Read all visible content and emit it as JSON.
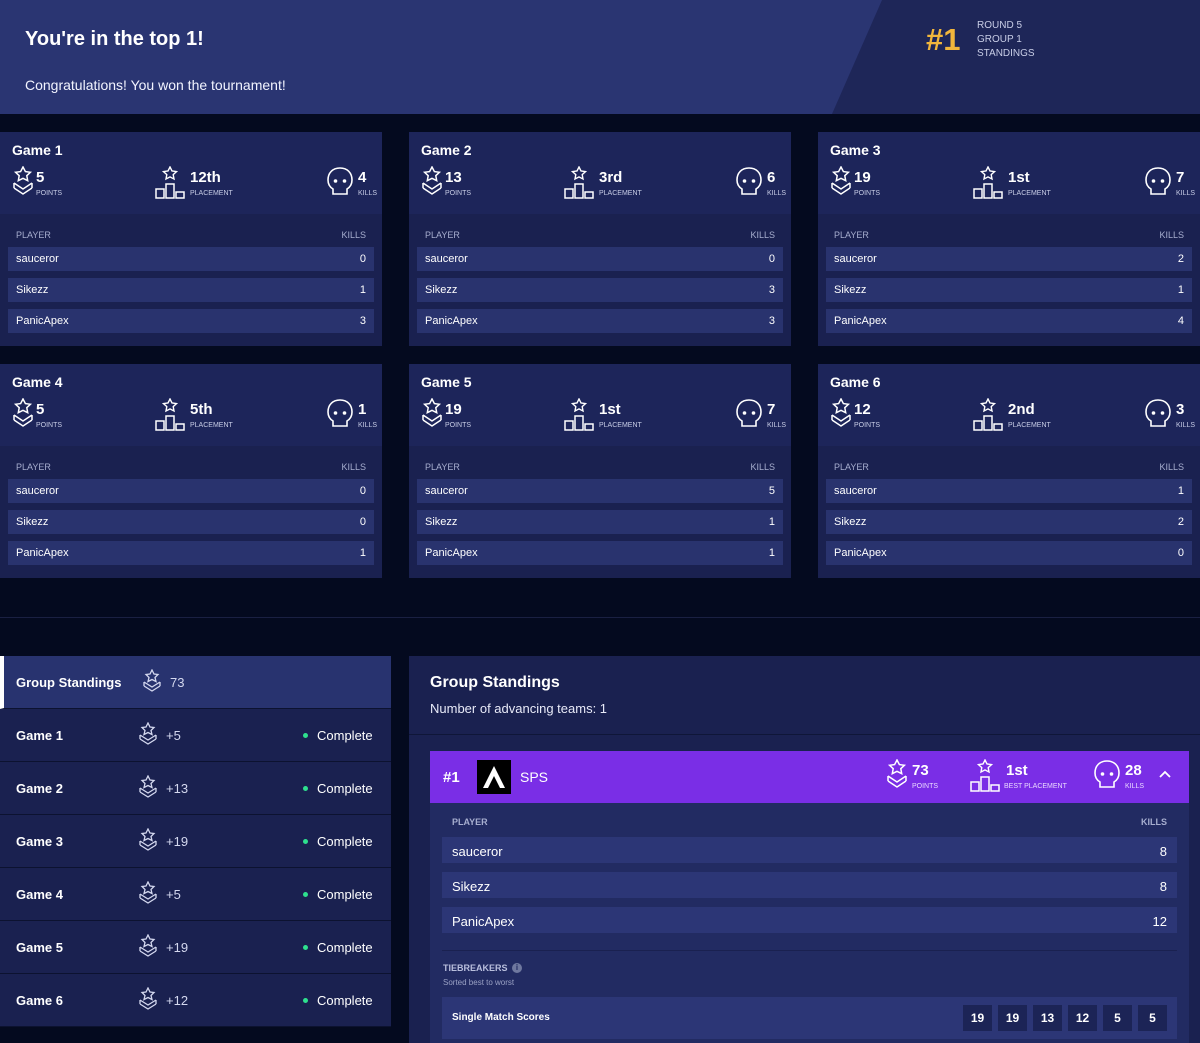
{
  "banner": {
    "title": "You're in the top 1!",
    "subtitle": "Congratulations! You won the tournament!",
    "rank": "#1",
    "meta": [
      "ROUND 5",
      "GROUP 1",
      "STANDINGS"
    ]
  },
  "labels": {
    "points": "POINTS",
    "placement": "PLACEMENT",
    "kills": "KILLS",
    "player": "PLAYER",
    "kills_col": "KILLS"
  },
  "games": [
    {
      "title": "Game 1",
      "points": "5",
      "placement": "12th",
      "kills": "4",
      "players": [
        [
          "sauceror",
          "0"
        ],
        [
          "Sikezz",
          "1"
        ],
        [
          "PanicApex",
          "3"
        ]
      ]
    },
    {
      "title": "Game 2",
      "points": "13",
      "placement": "3rd",
      "kills": "6",
      "players": [
        [
          "sauceror",
          "0"
        ],
        [
          "Sikezz",
          "3"
        ],
        [
          "PanicApex",
          "3"
        ]
      ]
    },
    {
      "title": "Game 3",
      "points": "19",
      "placement": "1st",
      "kills": "7",
      "players": [
        [
          "sauceror",
          "2"
        ],
        [
          "Sikezz",
          "1"
        ],
        [
          "PanicApex",
          "4"
        ]
      ]
    },
    {
      "title": "Game 4",
      "points": "5",
      "placement": "5th",
      "kills": "1",
      "players": [
        [
          "sauceror",
          "0"
        ],
        [
          "Sikezz",
          "0"
        ],
        [
          "PanicApex",
          "1"
        ]
      ]
    },
    {
      "title": "Game 5",
      "points": "19",
      "placement": "1st",
      "kills": "7",
      "players": [
        [
          "sauceror",
          "5"
        ],
        [
          "Sikezz",
          "1"
        ],
        [
          "PanicApex",
          "1"
        ]
      ]
    },
    {
      "title": "Game 6",
      "points": "12",
      "placement": "2nd",
      "kills": "3",
      "players": [
        [
          "sauceror",
          "1"
        ],
        [
          "Sikezz",
          "2"
        ],
        [
          "PanicApex",
          "0"
        ]
      ]
    }
  ],
  "sidebar": {
    "header": {
      "label": "Group Standings",
      "points": "73"
    },
    "items": [
      {
        "label": "Game 1",
        "points": "+5",
        "status": "Complete"
      },
      {
        "label": "Game 2",
        "points": "+13",
        "status": "Complete"
      },
      {
        "label": "Game 3",
        "points": "+19",
        "status": "Complete"
      },
      {
        "label": "Game 4",
        "points": "+5",
        "status": "Complete"
      },
      {
        "label": "Game 5",
        "points": "+19",
        "status": "Complete"
      },
      {
        "label": "Game 6",
        "points": "+12",
        "status": "Complete"
      }
    ]
  },
  "standings": {
    "title": "Group Standings",
    "advancing": "Number of advancing teams: 1",
    "team": {
      "rank": "#1",
      "name": "SPS",
      "points": "73",
      "points_label": "POINTS",
      "best_placement": "1st",
      "best_placement_label": "BEST PLACEMENT",
      "kills": "28",
      "kills_label": "KILLS",
      "players": [
        [
          "sauceror",
          "8"
        ],
        [
          "Sikezz",
          "8"
        ],
        [
          "PanicApex",
          "12"
        ]
      ]
    },
    "player_header": "PLAYER",
    "kills_header": "KILLS",
    "tiebreakers": {
      "title": "TIEBREAKERS",
      "info": "i",
      "subtitle": "Sorted best to worst",
      "row_label": "Single Match Scores",
      "scores": [
        "19",
        "19",
        "13",
        "12",
        "5",
        "5"
      ]
    }
  },
  "colors": {
    "accent": "#f2b63c",
    "team": "#7a2ee6",
    "complete": "#2ee08e"
  }
}
